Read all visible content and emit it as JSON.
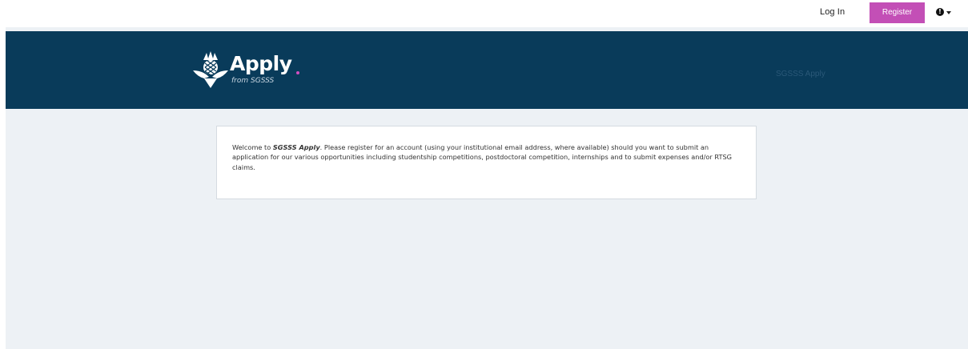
{
  "topbar": {
    "login_label": "Log In",
    "register_label": "Register",
    "info_icon": "info-circle-icon",
    "caret_icon": "chevron-down-icon"
  },
  "header": {
    "logo_text": "Apply",
    "logo_subtitle": "from SGSSS",
    "brand_right": "SGSSS Apply"
  },
  "welcome": {
    "prefix": "Welcome to ",
    "brand": "SGSSS Apply",
    "body": ". Please register for an account (using your institutional email address, where available) should you want to submit an application for our various opportunities including studentship competitions, postdoctoral competition, internships and to submit expenses and/or RTSG claims."
  },
  "colors": {
    "header_bg": "#093b5a",
    "page_bg": "#edf1f5",
    "accent": "#c34fb6"
  }
}
